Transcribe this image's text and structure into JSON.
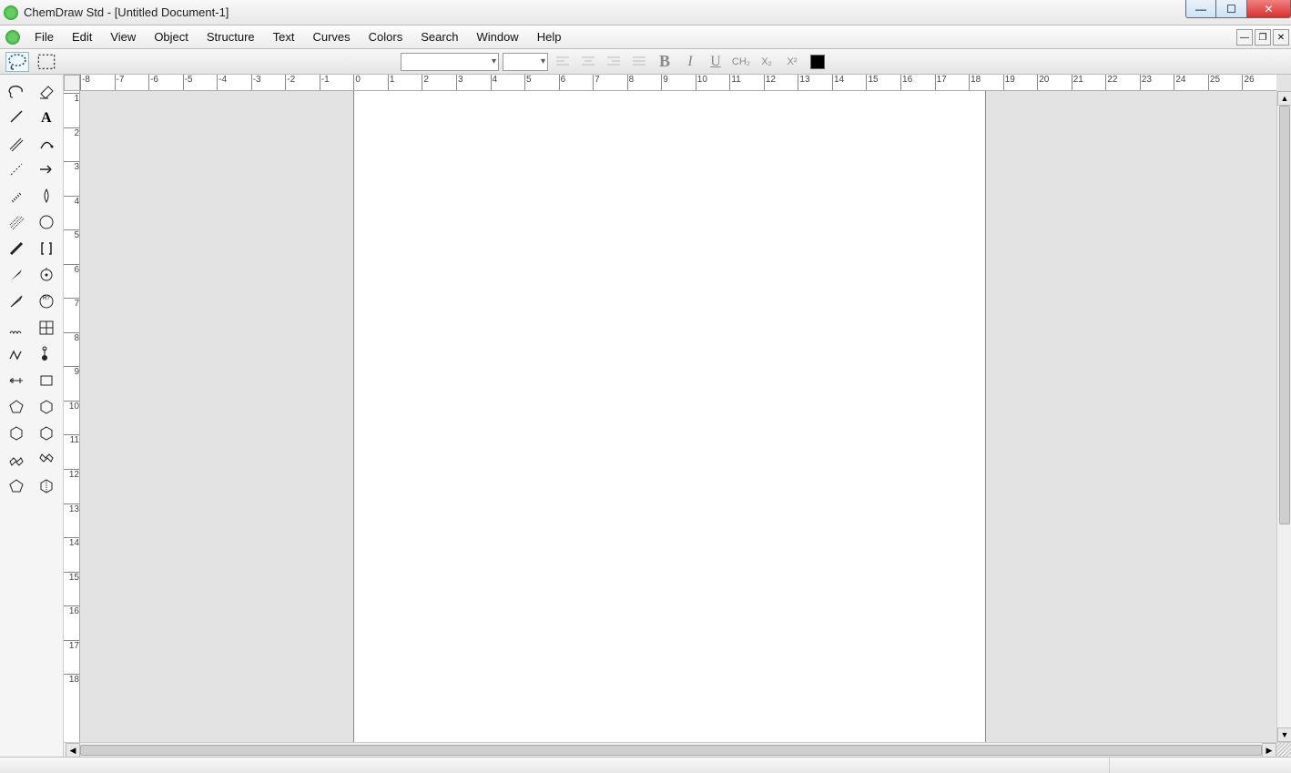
{
  "title": "ChemDraw Std - [Untitled Document-1]",
  "menu": [
    "File",
    "Edit",
    "View",
    "Object",
    "Structure",
    "Text",
    "Curves",
    "Colors",
    "Search",
    "Window",
    "Help"
  ],
  "format": {
    "bold": "B",
    "italic": "I",
    "underline": "U",
    "ch2": "CH₂",
    "sub": "X₂",
    "sup": "X²"
  },
  "ruler": {
    "h_start": -8,
    "h_end": 26,
    "v_start": 1,
    "v_end": 18,
    "page_left_unit": 0,
    "page_right_unit": 18.5
  },
  "tools": [
    [
      "lasso",
      "eraser"
    ],
    [
      "single-bond",
      "text-atom"
    ],
    [
      "multiple-bonds",
      "pen"
    ],
    [
      "dashed-bond",
      "arrow"
    ],
    [
      "hashed-bond",
      "orbital"
    ],
    [
      "wavy-bonds",
      "circle-draw"
    ],
    [
      "bold-bond",
      "brackets"
    ],
    [
      "wedge-bond",
      "chemical-symbol"
    ],
    [
      "hollow-wedge",
      "query"
    ],
    [
      "squiggle-bond",
      "table"
    ],
    [
      "chain",
      "tlc-plate"
    ],
    [
      "acyclic-chain",
      "rectangle"
    ],
    [
      "cyclopentadiene",
      "benzene"
    ],
    [
      "cyclohexane",
      "cyclohexane-alt"
    ],
    [
      "chair-a",
      "chair-b"
    ],
    [
      "cyclopentane",
      "cyclohexane-3d"
    ]
  ]
}
